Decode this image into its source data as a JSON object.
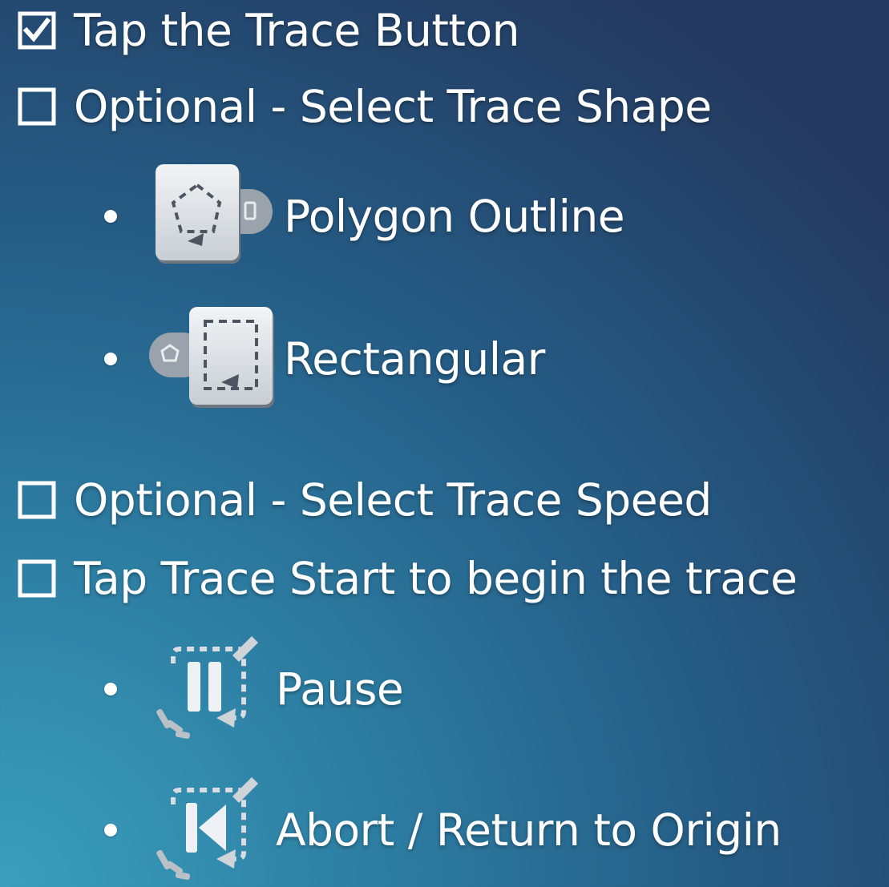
{
  "checklist": [
    {
      "checkbox_glyph": "☑",
      "checked": true,
      "text": "Tap the Trace Button"
    },
    {
      "checkbox_glyph": "☐",
      "checked": false,
      "text": "Optional - Select Trace Shape"
    },
    {
      "checkbox_glyph": "☐",
      "checked": false,
      "text": "Optional - Select Trace Speed"
    },
    {
      "checkbox_glyph": "☐",
      "checked": false,
      "text": "Tap Trace Start to begin the trace"
    }
  ],
  "shape_options": [
    {
      "icon": "polygon-outline-toggle-icon",
      "label": "Polygon Outline"
    },
    {
      "icon": "rectangular-toggle-icon",
      "label": "Rectangular"
    }
  ],
  "trace_controls": [
    {
      "icon": "trace-pause-icon",
      "label": "Pause"
    },
    {
      "icon": "trace-abort-return-icon",
      "label": "Abort / Return to Origin"
    }
  ],
  "colors": {
    "text": "#ffffff",
    "bg_top_right": "#24395f",
    "bg_bottom_left": "#3a9fbd",
    "icon_face": "#e2e6ea"
  }
}
